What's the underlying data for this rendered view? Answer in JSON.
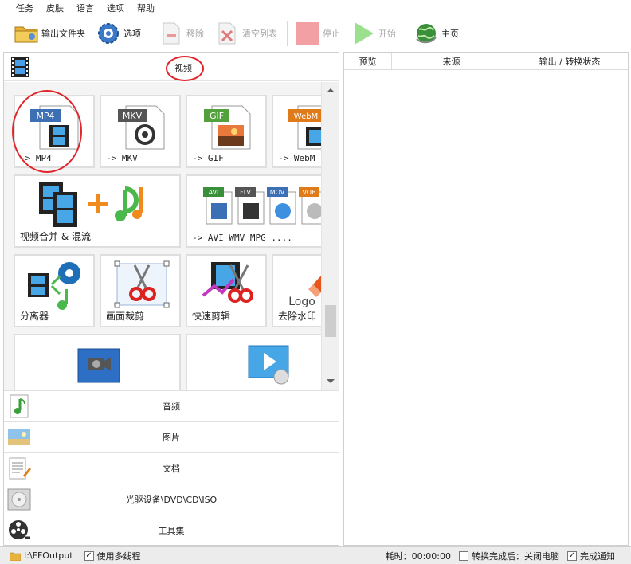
{
  "menu": [
    "任务",
    "皮肤",
    "语言",
    "选项",
    "帮助"
  ],
  "toolbar": {
    "output_folder": "输出文件夹",
    "options": "选项",
    "remove": "移除",
    "clear_list": "清空列表",
    "stop": "停止",
    "start": "开始",
    "home": "主页"
  },
  "video": {
    "header": "视频",
    "tiles": {
      "mp4": {
        "badge": "MP4",
        "label": "-> MP4"
      },
      "mkv": {
        "badge": "MKV",
        "label": "-> MKV"
      },
      "gif": {
        "badge": "GIF",
        "label": "-> GIF"
      },
      "webm": {
        "badge": "WebM",
        "label": "-> WebM"
      },
      "merge": {
        "label": "视频合并 & 混流"
      },
      "multi": {
        "label": "-> AVI WMV MPG ....",
        "badges": [
          "AVI",
          "FLV",
          "MOV",
          "VOB"
        ]
      },
      "splitter": {
        "label": "分离器"
      },
      "crop": {
        "label": "画面裁剪"
      },
      "quick_cut": {
        "label": "快速剪辑"
      },
      "watermark": {
        "label": "去除水印",
        "logo_text": "Logo"
      }
    }
  },
  "categories": {
    "audio": "音频",
    "picture": "图片",
    "document": "文档",
    "optical": "光驱设备\\DVD\\CD\\ISO",
    "tools": "工具集"
  },
  "list": {
    "columns": [
      "预览",
      "来源",
      "输出 / 转换状态"
    ]
  },
  "status": {
    "output_path": "I:\\FFOutput",
    "multithread": "使用多线程",
    "elapsed": "耗时：00:00:00",
    "after_convert": "转换完成后：关闭电脑",
    "notify": "完成通知"
  },
  "colors": {
    "accent_red": "#e0262b",
    "mp4_badge": "#3d6fb4",
    "mkv_badge": "#555555",
    "gif_badge": "#52a13d",
    "webm_badge": "#e07b1a"
  }
}
